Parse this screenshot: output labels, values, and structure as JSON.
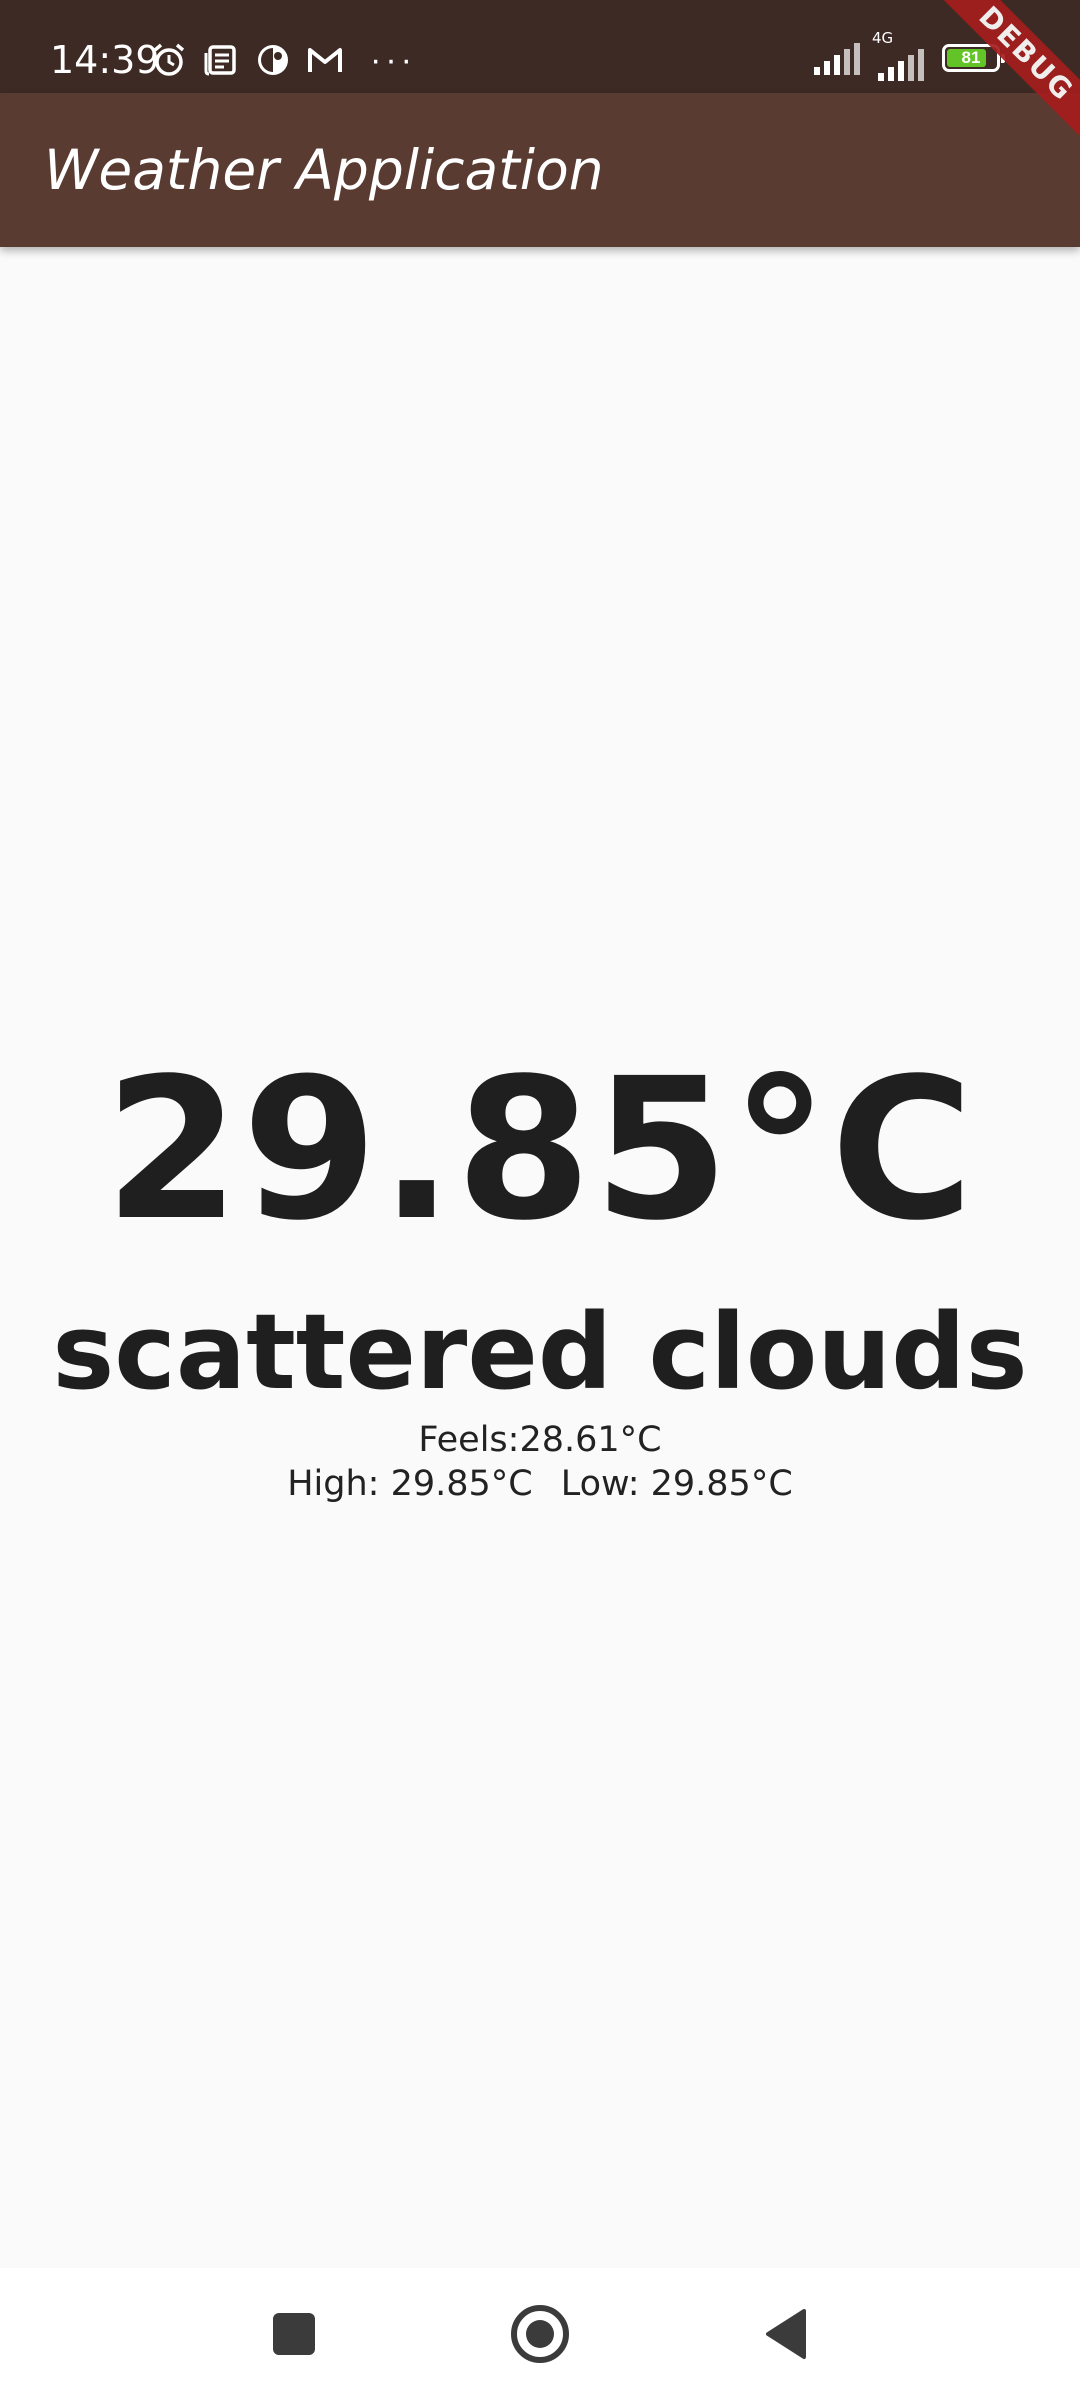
{
  "status_bar": {
    "time": "14:39",
    "network_label": "4G",
    "battery_level": "81",
    "battery_fraction": 0.81,
    "icons": [
      "alarm-icon",
      "news-icon",
      "app-icon",
      "gmail-icon",
      "more-dots-icon",
      "signal-icon",
      "battery-icon"
    ],
    "more_dots": "···"
  },
  "app_bar": {
    "title": "Weather Application"
  },
  "debug_banner": {
    "label": "DEBUG"
  },
  "weather": {
    "temperature": "29.85°C",
    "description": "scattered clouds",
    "feels": "Feels:28.61°C",
    "high": "High: 29.85°C",
    "low": "Low: 29.85°C"
  },
  "nav_bar": {
    "buttons": [
      "recent-apps-button",
      "home-button",
      "back-button"
    ]
  },
  "colors": {
    "status_bar": "#3e2a24",
    "app_bar": "#593b31",
    "background": "#fafafa",
    "text": "#1f1f1f",
    "battery_fill": "#62c426",
    "debug_banner": "#a51d1d"
  }
}
